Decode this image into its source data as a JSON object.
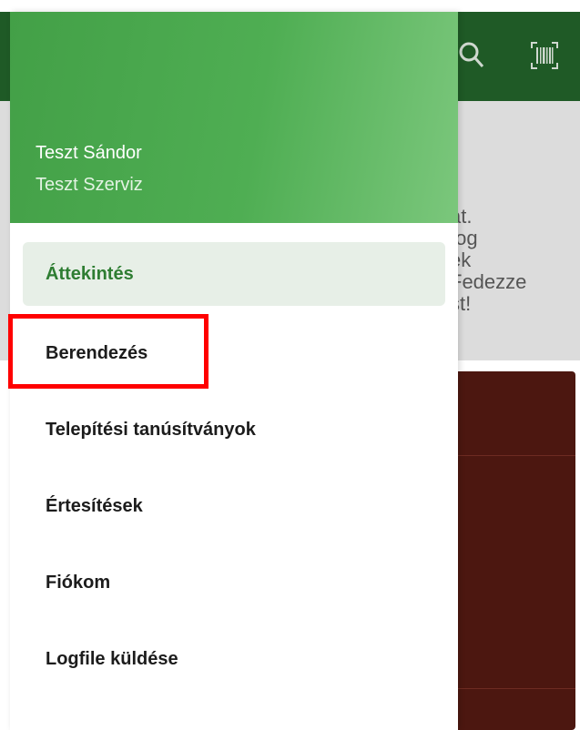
{
  "background": {
    "text": "át.\n fog\nek\nFedezze\nst!",
    "colors": {
      "topbar": "#1f5a26",
      "card": "#4c1710"
    }
  },
  "drawer": {
    "user": {
      "name": "Teszt Sándor",
      "org": "Teszt Szerviz"
    },
    "items": [
      {
        "label": "Áttekintés",
        "active": true
      },
      {
        "label": "Berendezés",
        "active": false
      },
      {
        "label": "Telepítési tanúsítványok",
        "active": false
      },
      {
        "label": "Értesítések",
        "active": false
      },
      {
        "label": "Fiókom",
        "active": false
      },
      {
        "label": "Logfile küldése",
        "active": false
      }
    ],
    "colors": {
      "accent": "#2e7d32",
      "active_bg": "#e7efe7",
      "highlight": "#ff0000"
    }
  }
}
